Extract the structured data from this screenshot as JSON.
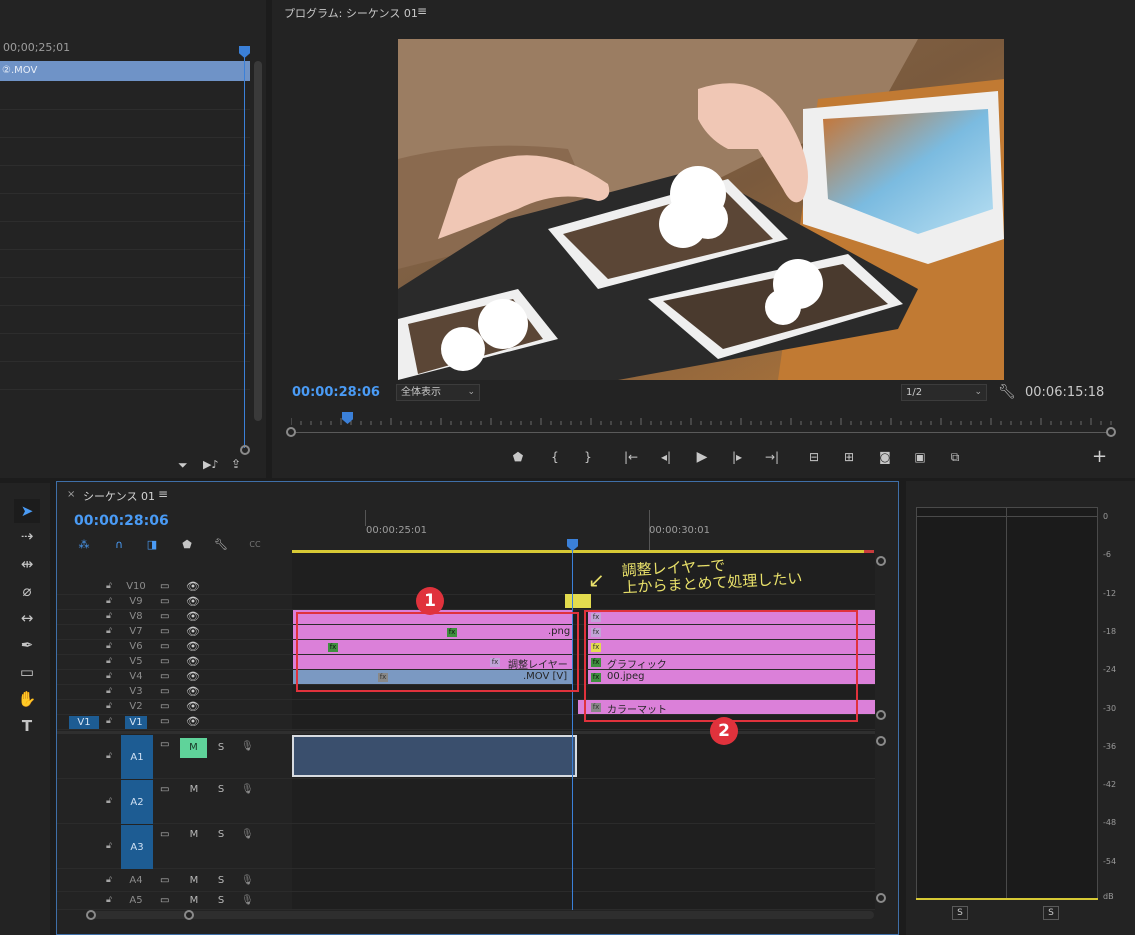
{
  "source_panel": {
    "timecode": "00;00;25;01",
    "clip_label": "②.MOV"
  },
  "program": {
    "title": "プログラム: シーケンス 01",
    "menu_icon": "≡",
    "timecode_current": "00:00:28:06",
    "fit_option": "全体表示",
    "resolution": "1/2",
    "timecode_duration": "00:06:15:18",
    "video_description_icon": "photo-album-image"
  },
  "timeline": {
    "tab_close": "×",
    "tab_title": "シーケンス 01",
    "tab_menu": "≡",
    "timecode": "00:00:28:06",
    "ruler_labels": [
      "00:00:25:01",
      "00:00:30:01"
    ],
    "video_tracks": [
      {
        "name": "V10"
      },
      {
        "name": "V9"
      },
      {
        "name": "V8"
      },
      {
        "name": "V7"
      },
      {
        "name": "V6"
      },
      {
        "name": "V5"
      },
      {
        "name": "V4"
      },
      {
        "name": "V3"
      },
      {
        "name": "V2"
      },
      {
        "name": "V1",
        "source": "V1"
      }
    ],
    "audio_tracks": [
      {
        "name": "A1",
        "m": "M",
        "s": "S"
      },
      {
        "name": "A2",
        "m": "M",
        "s": "S"
      },
      {
        "name": "A3",
        "m": "M",
        "s": "S"
      },
      {
        "name": "A4",
        "m": "M",
        "s": "S"
      },
      {
        "name": "A5",
        "m": "M",
        "s": "S"
      }
    ],
    "clips": {
      "png": ".png",
      "adjustment": "調整レイヤー",
      "mov": ".MOV [V]",
      "graphic": "グラフィック",
      "jpeg": "00.jpeg",
      "matte": "カラーマット",
      "fx": "fx"
    },
    "annotation_note_line1": "調整レイヤーで",
    "annotation_note_line2": "上からまとめて処理したい",
    "badge1": "1",
    "badge2": "2"
  },
  "meter": {
    "db_labels": [
      "0",
      "-6",
      "-12",
      "-18",
      "-24",
      "-30",
      "-36",
      "-42",
      "-48",
      "-54",
      "dB"
    ],
    "solo_left": "S",
    "solo_right": "S"
  },
  "colors": {
    "accent_blue": "#3b80d8",
    "clip_pink": "#db80d9",
    "clip_blue": "#7b99c2",
    "annotation_red": "#e0323c",
    "workarea_yellow": "#d7c935"
  }
}
